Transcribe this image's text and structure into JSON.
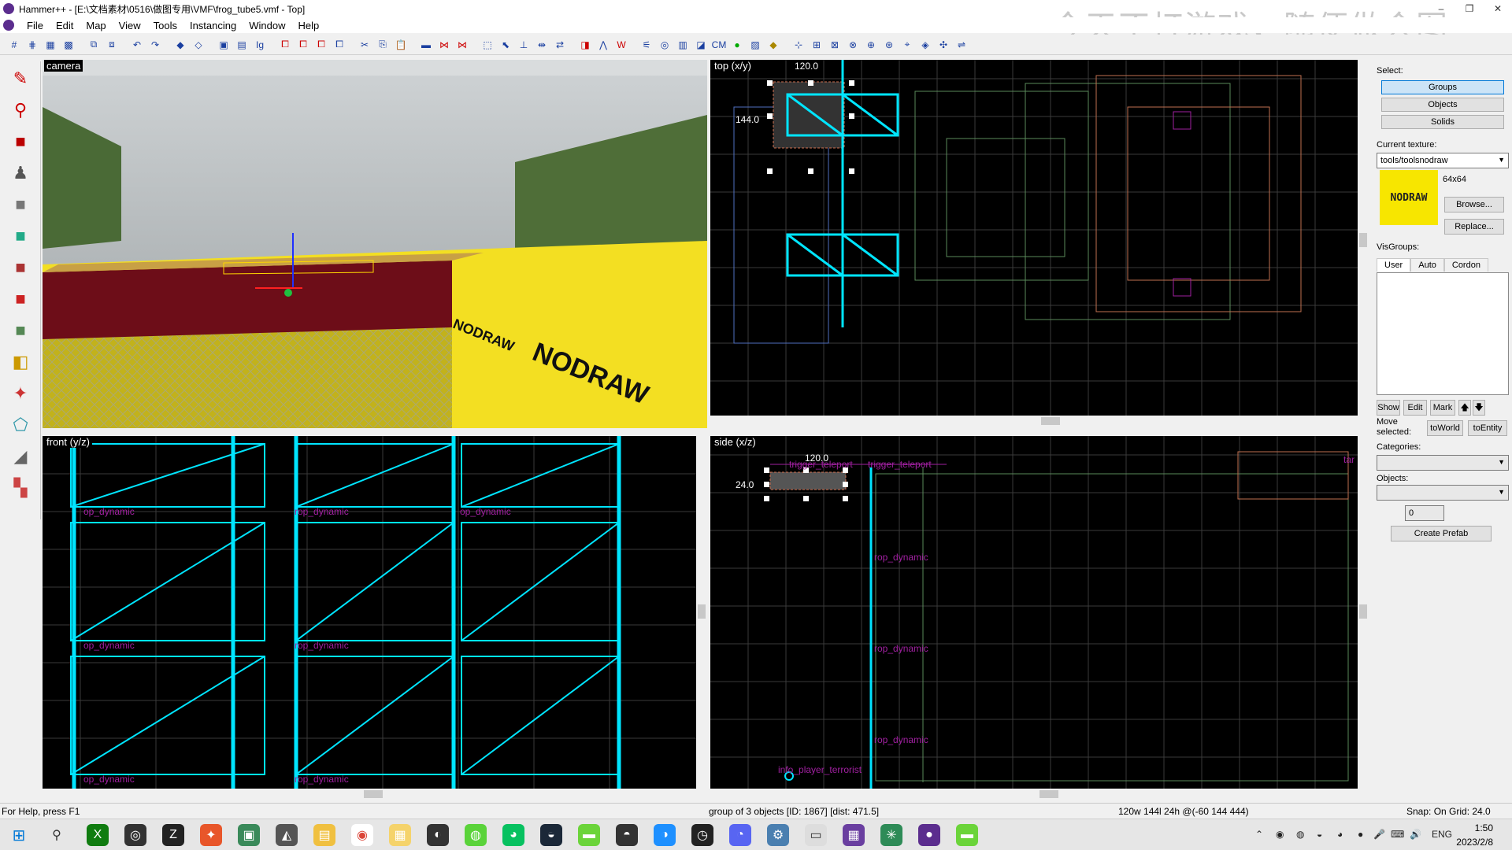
{
  "window": {
    "title": "Hammer++ - [E:\\文档素材\\0516\\做图专用\\VMF\\frog_tube5.vmf - Top]",
    "watermark": "今天不打游戏，随便做会图",
    "minimize": "–",
    "maximize": "❐",
    "close": "✕"
  },
  "menu": [
    "File",
    "Edit",
    "Map",
    "View",
    "Tools",
    "Instancing",
    "Window",
    "Help"
  ],
  "viewports": {
    "camera": {
      "label": "camera",
      "tex_text_1": "NODRAW",
      "tex_text_2": "NODRAW"
    },
    "top": {
      "label": "top (x/y)",
      "dim_w": "120.0",
      "dim_h": "144.0"
    },
    "front": {
      "label": "front (y/z)",
      "ent_label": "op_dynamic",
      "ent_label_2": "rop_dynamic"
    },
    "side": {
      "label": "side (x/z)",
      "dim_w": "120.0",
      "dim_h": "24.0",
      "ent_trigger": "trigger_teleport",
      "ent_trigger_2": "trigger_teleport",
      "ent_prop": "rop_dynamic",
      "ent_player": "info_player_terrorist",
      "ent_edge": "tar"
    }
  },
  "right_panel": {
    "select_label": "Select:",
    "select_buttons": [
      "Groups",
      "Objects",
      "Solids"
    ],
    "current_texture_label": "Current texture:",
    "current_texture": "tools/toolsnodraw",
    "texture_size": "64x64",
    "texture_preview_text": "NODRAW",
    "browse": "Browse...",
    "replace": "Replace...",
    "visgroups_label": "VisGroups:",
    "visgroup_tabs": [
      "User",
      "Auto",
      "Cordon"
    ],
    "vg_buttons": [
      "Show",
      "Edit",
      "Mark",
      "🡅",
      "🡇"
    ],
    "move_selected_label": "Move selected:",
    "to_world": "toWorld",
    "to_entity": "toEntity",
    "categories_label": "Categories:",
    "objects_label": "Objects:",
    "count_value": "0",
    "create_prefab": "Create Prefab"
  },
  "status": {
    "help": "For Help, press F1",
    "selection": "group of 3 objects  [ID: 1867]  [dist: 471.5]",
    "dims": "120w 144l 24h @(-60 144 444)",
    "snap": "Snap: On Grid: 24.0"
  },
  "taskbar": {
    "lang": "ENG",
    "time": "1:50",
    "date": "2023/2/8"
  }
}
